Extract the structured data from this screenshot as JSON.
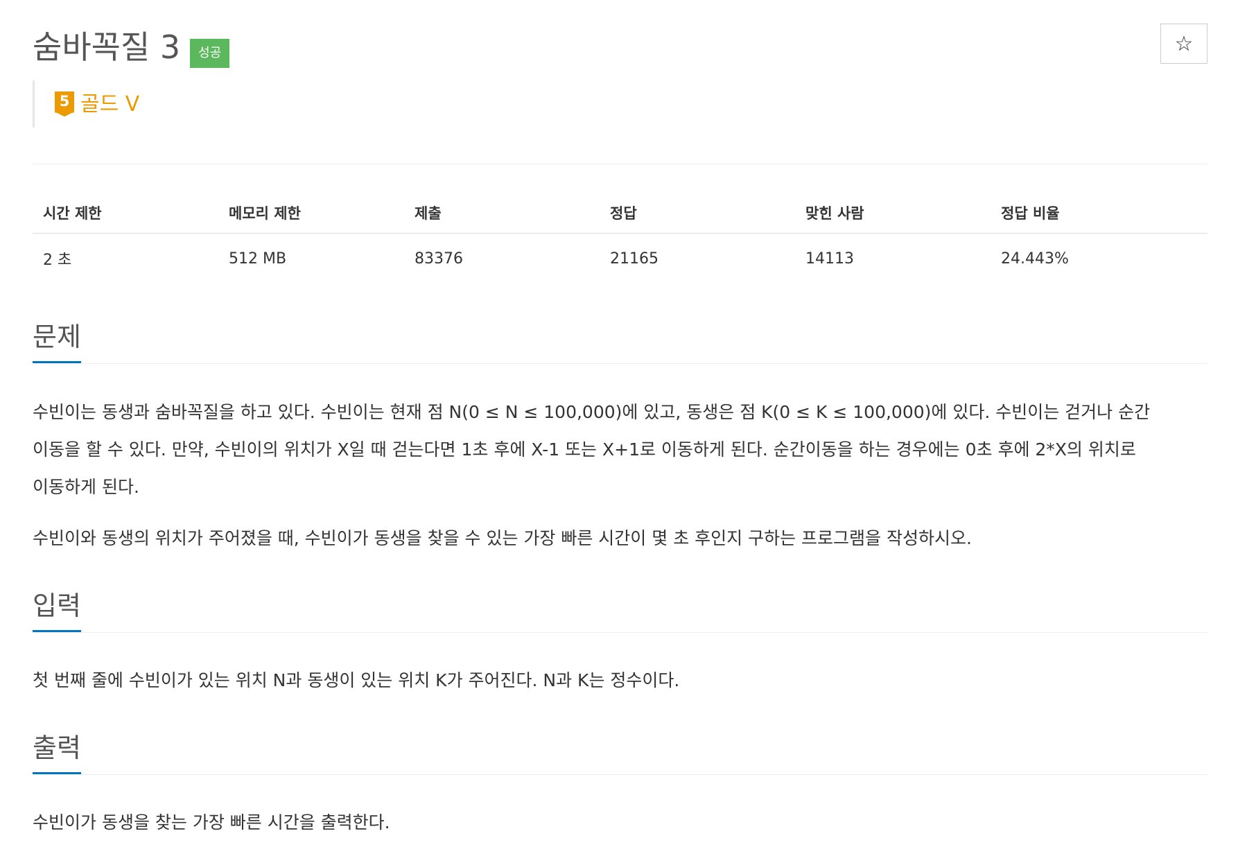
{
  "problem": {
    "title": "숨바꼭질 3",
    "status_badge": "성공",
    "star_glyph": "☆",
    "tier": {
      "number": "5",
      "label": "골드 V",
      "color": "#ec9a00",
      "icon": "gold-tier-icon"
    }
  },
  "info_table": {
    "headers": [
      "시간 제한",
      "메모리 제한",
      "제출",
      "정답",
      "맞힌 사람",
      "정답 비율"
    ],
    "values": [
      "2 초",
      "512 MB",
      "83376",
      "21165",
      "14113",
      "24.443%"
    ]
  },
  "sections": {
    "description": {
      "title": "문제",
      "paragraph1_lines": [
        "수빈이는 동생과 숨바꼭질을 하고 있다. 수빈이는 현재 점 N(0 ≤ N ≤ 100,000)에 있고, 동생은 점 K(0 ≤ K ≤ 100,000)에 있다. 수빈이는 걷거나 순간",
        "이동을 할 수 있다. 만약, 수빈이의 위치가 X일 때 걷는다면 1초 후에 X-1 또는 X+1로 이동하게 된다. 순간이동을 하는 경우에는 0초 후에 2*X의 위치로",
        "이동하게 된다."
      ],
      "paragraph2": "수빈이와 동생의 위치가 주어졌을 때, 수빈이가 동생을 찾을 수 있는 가장 빠른 시간이 몇 초 후인지 구하는 프로그램을 작성하시오."
    },
    "input": {
      "title": "입력",
      "text": "첫 번째 줄에 수빈이가 있는 위치 N과 동생이 있는 위치 K가 주어진다. N과 K는 정수이다."
    },
    "output": {
      "title": "출력",
      "text": "수빈이가 동생을 찾는 가장 빠른 시간을 출력한다."
    }
  },
  "colors": {
    "success": "#5cb85c",
    "section_underline": "#0076c0",
    "tier_gold": "#ec9a00"
  }
}
